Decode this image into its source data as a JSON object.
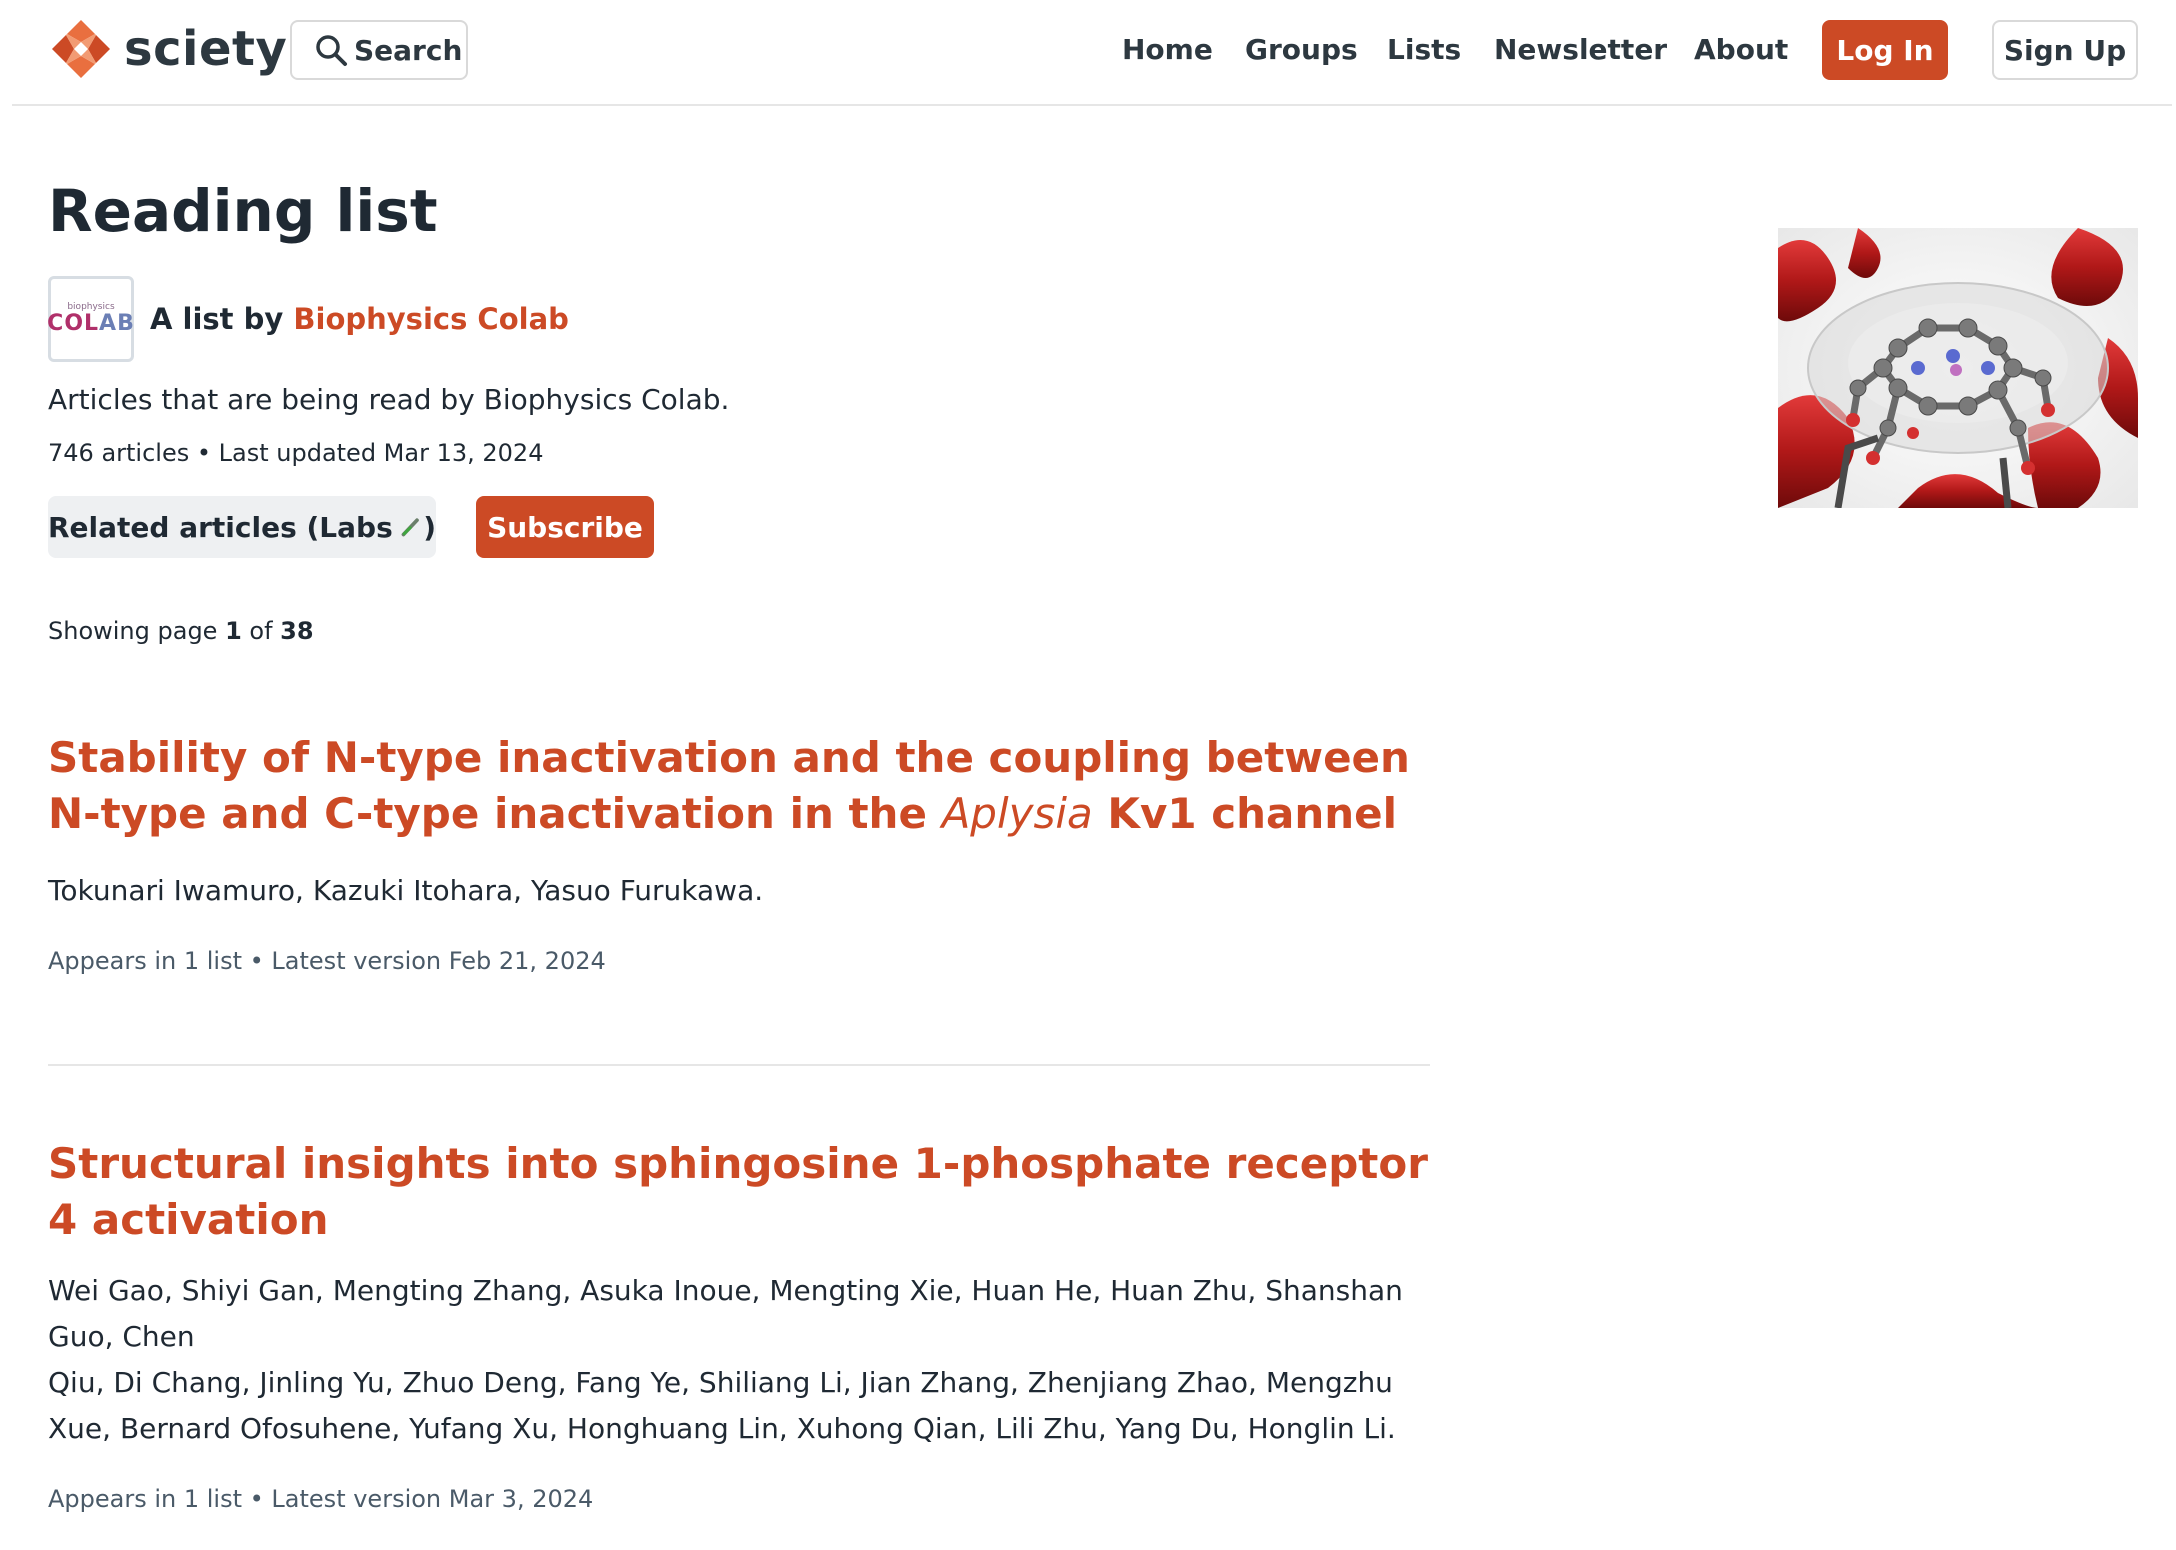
{
  "header": {
    "logo_text": "sciety",
    "search_label": "Search",
    "nav": [
      "Home",
      "Groups",
      "Lists",
      "Newsletter",
      "About"
    ],
    "login_label": "Log In",
    "signup_label": "Sign Up",
    "brand_color": "#cc4a25"
  },
  "list": {
    "title": "Reading list",
    "owner_prefix": "A list by ",
    "owner_name": "Biophysics Colab",
    "owner_avatar_small": "biophysics",
    "owner_avatar_big_a": "COL",
    "owner_avatar_big_b": "AB",
    "description": "Articles that are being read by Biophysics Colab.",
    "meta": "746 articles • Last updated Mar 13, 2024",
    "related_label": "Related articles (Labs",
    "related_suffix": ")",
    "subscribe_label": "Subscribe",
    "paging_prefix": "Showing page ",
    "page_current": "1",
    "paging_of": " of ",
    "page_total": "38"
  },
  "articles": [
    {
      "title_part1": "Stability of N-type inactivation and the coupling between N-type and C-type inactivation in the ",
      "title_italic": "Aplysia",
      "title_part2": " Kv1 channel",
      "authors": "Tokunari Iwamuro, Kazuki Itohara, Yasuo Furukawa.",
      "meta": "Appears in 1 list • Latest version Feb 21, 2024"
    },
    {
      "title": "Structural insights into sphingosine 1-phosphate receptor 4 activation",
      "authors_line1": "Wei Gao, Shiyi Gan, Mengting Zhang, Asuka Inoue, Mengting Xie, Huan He, Huan Zhu, Shanshan Guo, Chen",
      "authors_line2": "Qiu, Di Chang, Jinling Yu, Zhuo Deng, Fang Ye, Shiliang Li, Jian Zhang, Zhenjiang Zhao, Mengzhu",
      "authors_line3": "Xue, Bernard Ofosuhene, Yufang Xu, Honghuang Lin, Xuhong Qian, Lili Zhu, Yang Du, Honglin Li.",
      "meta": "Appears in 1 list • Latest version Mar 3, 2024"
    }
  ]
}
